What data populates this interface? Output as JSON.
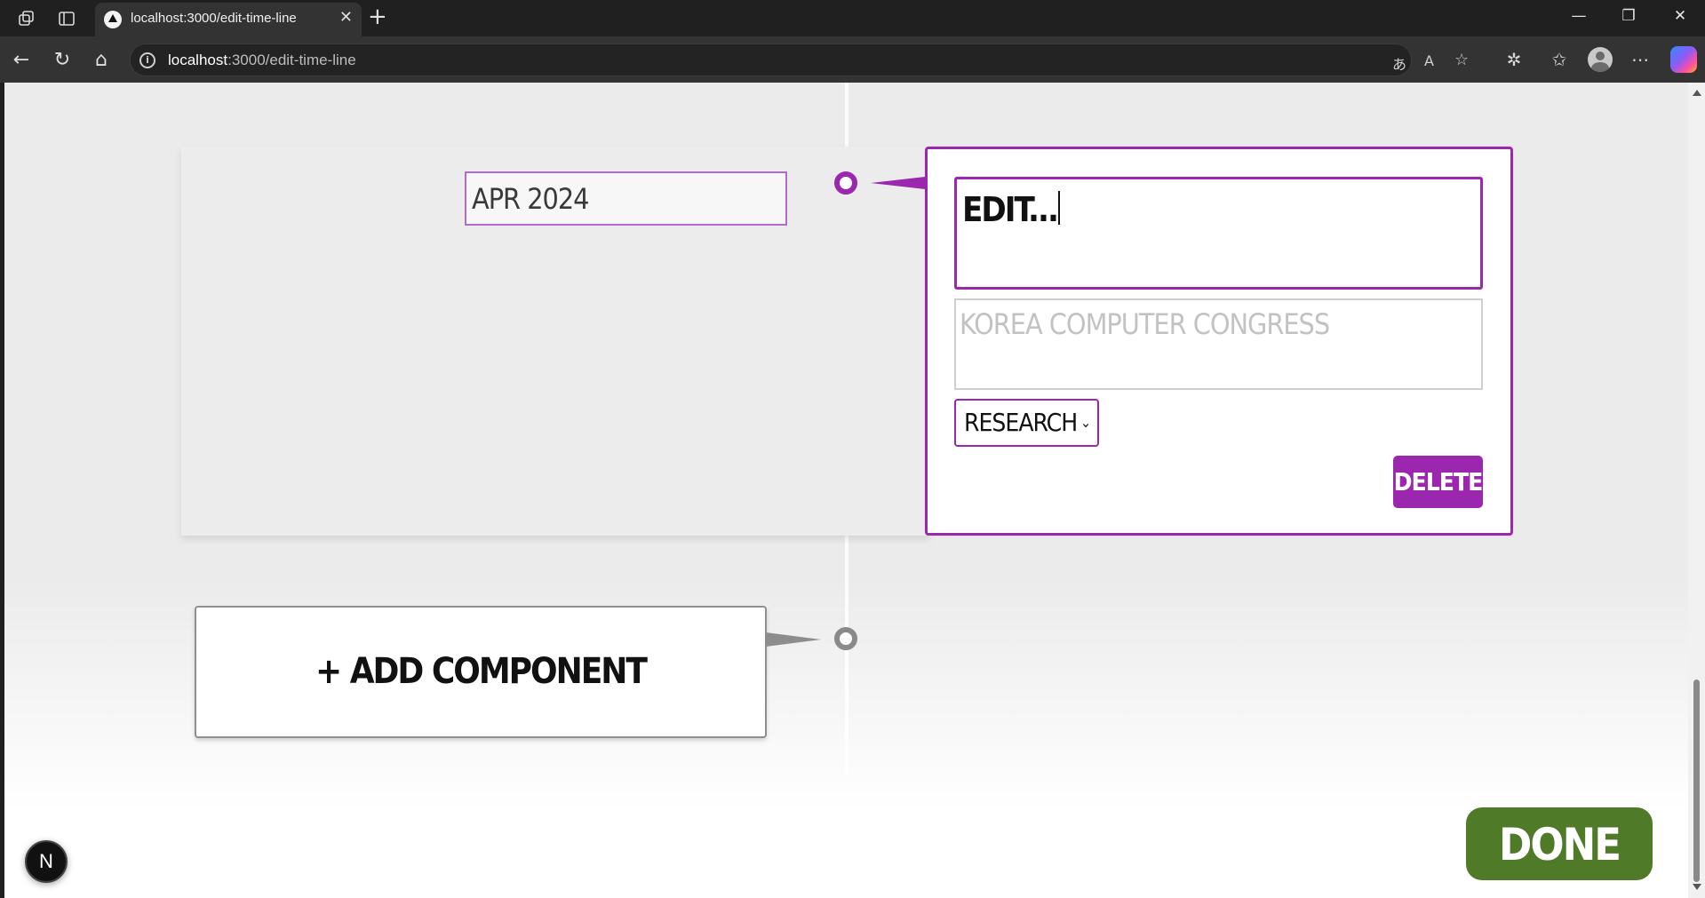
{
  "browser": {
    "tab_title": "localhost:3000/edit-time-line",
    "new_tab_symbol": "+",
    "url_host": "localhost",
    "url_rest": ":3000/edit-time-line",
    "window_controls": {
      "minimize": "—",
      "restore": "❐",
      "close": "✕"
    },
    "icons": [
      "workspaces-icon",
      "tab-actions-icon",
      "back-icon",
      "refresh-icon",
      "home-icon",
      "site-info-icon",
      "translate-icon",
      "read-aloud-icon",
      "favorite-star-icon",
      "extensions-icon",
      "favorites-icon",
      "profile-icon",
      "more-icon",
      "copilot-icon"
    ]
  },
  "timeline": {
    "entry": {
      "date": "Apr 2024",
      "title": "Edit...",
      "description": "Korea Computer Congress",
      "category": "Research",
      "delete_label": "Delete"
    },
    "add_component_label": "+ Add Component"
  },
  "done_label": "Done",
  "dev_badge": "N",
  "colors": {
    "accent_purple": "#9b27af",
    "done_green": "#4f7a27",
    "marker_gray": "#8a8a8a"
  }
}
